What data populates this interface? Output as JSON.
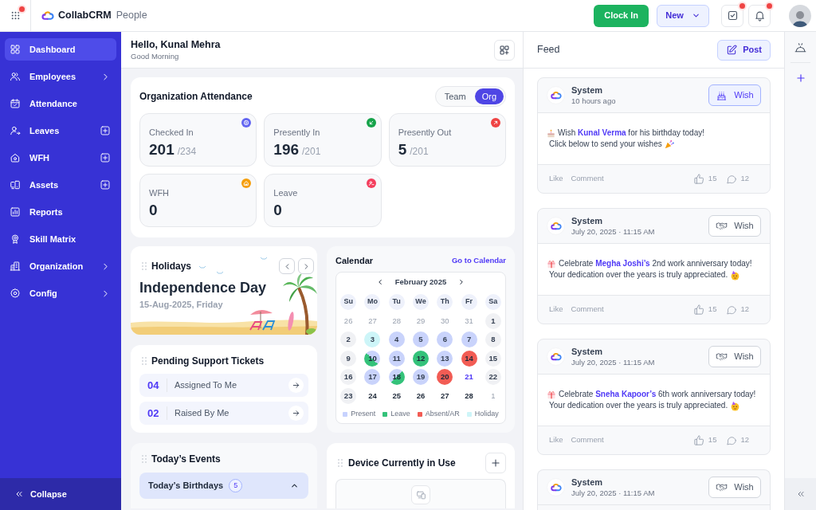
{
  "topbar": {
    "apps_notify": true,
    "app_name": "CollabCRM",
    "module": "People",
    "clock_in": "Clock In",
    "new_label": "New",
    "tasks_notify": true,
    "alerts_notify": true
  },
  "sidebar": {
    "items": [
      {
        "label": "Dashboard",
        "kind": "link",
        "selected": true
      },
      {
        "label": "Employees",
        "kind": "expandable",
        "selected": false
      },
      {
        "label": "Attendance",
        "kind": "link",
        "selected": false
      },
      {
        "label": "Leaves",
        "kind": "quick_add",
        "selected": false
      },
      {
        "label": "WFH",
        "kind": "quick_add",
        "selected": false
      },
      {
        "label": "Assets",
        "kind": "quick_add",
        "selected": false
      },
      {
        "label": "Reports",
        "kind": "link",
        "selected": false
      },
      {
        "label": "Skill Matrix",
        "kind": "link",
        "selected": false
      },
      {
        "label": "Organization",
        "kind": "expandable",
        "selected": false
      },
      {
        "label": "Config",
        "kind": "expandable",
        "selected": false
      }
    ],
    "collapse_label": "Collapse"
  },
  "greeting": {
    "title": "Hello, Kunal Mehra",
    "subtitle": "Good Morning"
  },
  "attendance": {
    "title": "Organization Attendance",
    "scopes": [
      {
        "label": "Team",
        "selected": false
      },
      {
        "label": "Org",
        "selected": true
      }
    ],
    "stats": [
      {
        "label": "Checked In",
        "value": "201",
        "total": "/234",
        "color": "#6366f1"
      },
      {
        "label": "Presently In",
        "value": "196",
        "total": "/201",
        "color": "#16a34a"
      },
      {
        "label": "Presently Out",
        "value": "5",
        "total": "/201",
        "color": "#ef4444"
      },
      {
        "label": "WFH",
        "value": "0",
        "color": "#f59e0b"
      },
      {
        "label": "Leave",
        "value": "0",
        "color": "#f43f5e"
      }
    ]
  },
  "holidays": {
    "title": "Holidays",
    "name": "Independence Day",
    "date": "15-Aug-2025, Friday"
  },
  "calendar": {
    "title": "Calendar",
    "link": "Go to Calendar",
    "month": "February 2025",
    "weekdays": [
      "Su",
      "Mo",
      "Tu",
      "We",
      "Th",
      "Fr",
      "Sa"
    ],
    "days": [
      {
        "label": "26",
        "kind": "outside"
      },
      {
        "label": "27",
        "kind": "outside"
      },
      {
        "label": "28",
        "kind": "outside"
      },
      {
        "label": "29",
        "kind": "outside"
      },
      {
        "label": "30",
        "kind": "outside"
      },
      {
        "label": "31",
        "kind": "outside"
      },
      {
        "label": "1",
        "kind": "weekend"
      },
      {
        "label": "2",
        "kind": "weekend"
      },
      {
        "label": "3",
        "kind": "holiday"
      },
      {
        "label": "4",
        "kind": "present"
      },
      {
        "label": "5",
        "kind": "present"
      },
      {
        "label": "6",
        "kind": "present"
      },
      {
        "label": "7",
        "kind": "present"
      },
      {
        "label": "8",
        "kind": "weekend"
      },
      {
        "label": "9",
        "kind": "weekend"
      },
      {
        "label": "10",
        "kind": "first_half_leave"
      },
      {
        "label": "11",
        "kind": "present"
      },
      {
        "label": "12",
        "kind": "leave"
      },
      {
        "label": "13",
        "kind": "present"
      },
      {
        "label": "14",
        "kind": "absent"
      },
      {
        "label": "15",
        "kind": "weekend"
      },
      {
        "label": "16",
        "kind": "weekend"
      },
      {
        "label": "17",
        "kind": "present"
      },
      {
        "label": "18",
        "kind": "second_half_leave"
      },
      {
        "label": "19",
        "kind": "present"
      },
      {
        "label": "20",
        "kind": "absent"
      },
      {
        "label": "21",
        "kind": "today"
      },
      {
        "label": "22",
        "kind": "weekend"
      },
      {
        "label": "23",
        "kind": "weekend"
      },
      {
        "label": "24",
        "kind": "upcoming"
      },
      {
        "label": "25",
        "kind": "upcoming"
      },
      {
        "label": "26",
        "kind": "upcoming"
      },
      {
        "label": "27",
        "kind": "upcoming"
      },
      {
        "label": "28",
        "kind": "upcoming"
      },
      {
        "label": "1",
        "kind": "outside"
      }
    ],
    "legend": [
      {
        "label": "Present",
        "color": "#c7d2fe"
      },
      {
        "label": "Leave",
        "color": "#34c27a"
      },
      {
        "label": "Absent/AR",
        "color": "#f25c54"
      },
      {
        "label": "Holiday",
        "color": "#cdf5f8"
      }
    ]
  },
  "tickets": {
    "title": "Pending Support Tickets",
    "rows": [
      {
        "count": "04",
        "label": "Assigned To Me"
      },
      {
        "count": "02",
        "label": "Raised By Me"
      }
    ]
  },
  "events": {
    "title": "Today’s Events",
    "groups": [
      {
        "label": "Today’s Birthdays",
        "count": "5",
        "expanded": true
      }
    ]
  },
  "devices": {
    "title": "Device Currently in Use"
  },
  "feed": {
    "title": "Feed",
    "post_label": "Post",
    "posts": [
      {
        "kind": "birthday",
        "author": "System",
        "time": "10 hours ago",
        "wish_label": "Wish",
        "highlighted": true,
        "message": [
          "Wish **Kunal Verma** for his birthday today!",
          "Click below to send your wishes"
        ],
        "actions": [
          "Like",
          "Comment"
        ],
        "likes": "15",
        "comments": "12"
      },
      {
        "kind": "anniversary",
        "author": "System",
        "time": "July 20, 2025 · 11:15 AM",
        "wish_label": "Wish",
        "highlighted": false,
        "message": [
          "Celebrate **Megha Joshi’s** 2nd work anniversary today!",
          "Your dedication over the years is truly appreciated."
        ],
        "actions": [
          "Like",
          "Comment"
        ],
        "likes": "15",
        "comments": "12"
      },
      {
        "kind": "anniversary",
        "author": "System",
        "time": "July 20, 2025 · 11:15 AM",
        "wish_label": "Wish",
        "highlighted": false,
        "message": [
          "Celebrate **Sneha Kapoor’s** 6th work anniversary today!",
          "Your dedication over the years is truly appreciated."
        ],
        "actions": [
          "Like",
          "Comment"
        ],
        "likes": "15",
        "comments": "12"
      },
      {
        "kind": "anniversary",
        "author": "System",
        "time": "July 20, 2025 · 11:15 AM",
        "wish_label": "Wish",
        "highlighted": false
      }
    ]
  }
}
